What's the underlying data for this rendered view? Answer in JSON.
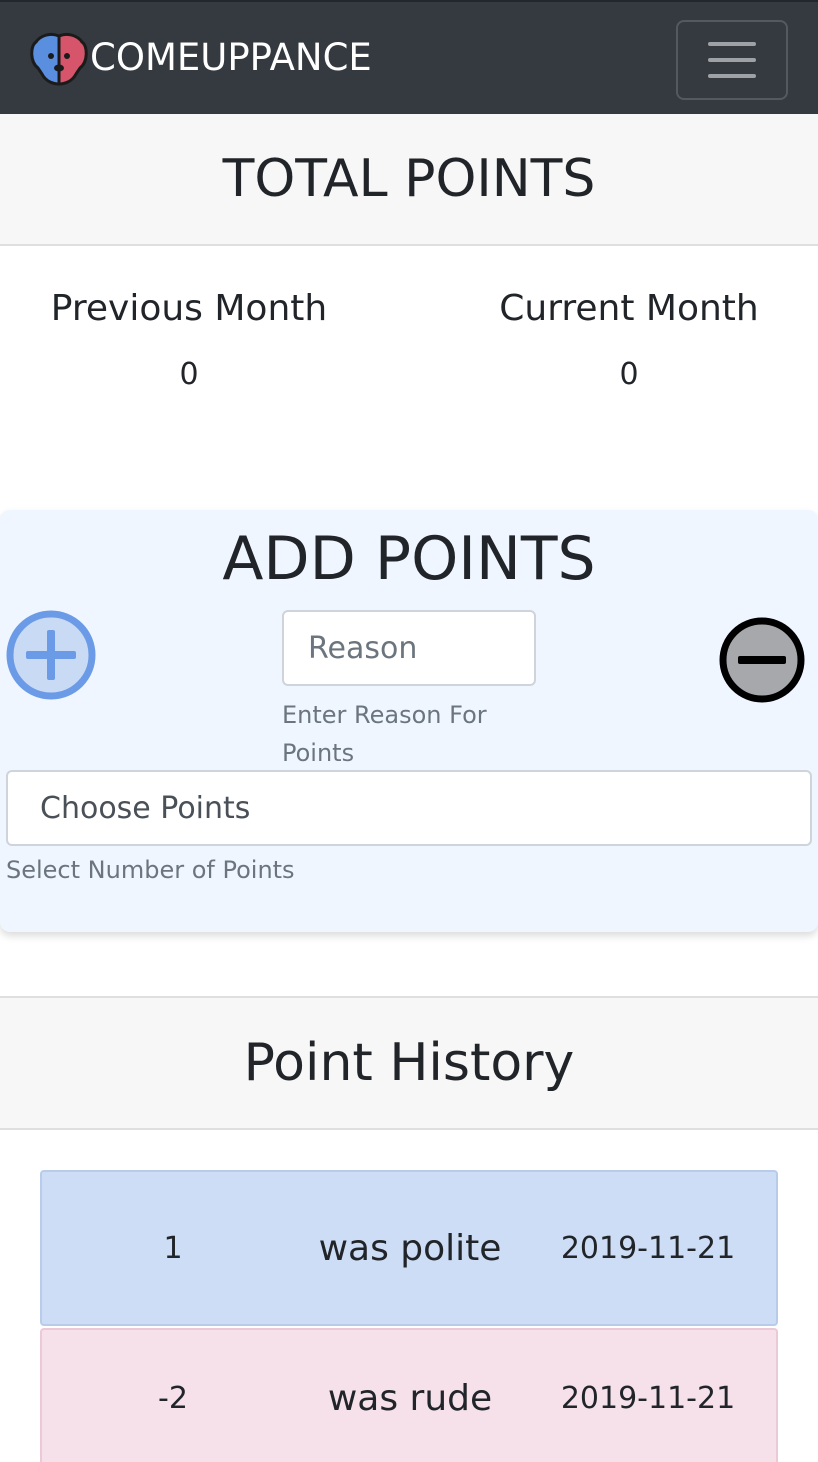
{
  "navbar": {
    "brand": "COMEUPPANCE",
    "logo_icon": "dog-face-logo-icon",
    "toggler_icon": "hamburger-menu-icon"
  },
  "total_points": {
    "title": "TOTAL POINTS",
    "previous_month": {
      "label": "Previous Month",
      "value": "0"
    },
    "current_month": {
      "label": "Current Month",
      "value": "0"
    }
  },
  "add_points": {
    "title": "ADD POINTS",
    "plus_icon": "plus-circle-icon",
    "minus_icon": "minus-circle-icon",
    "reason_placeholder": "Reason",
    "reason_help": "Enter Reason For Points",
    "points_select_value": "Choose Points",
    "points_help": "Select Number of Points",
    "colors": {
      "plus": "#6b9be6",
      "minus": "#000000",
      "card_bg": "#eff6ff"
    }
  },
  "point_history": {
    "title": "Point History",
    "rows": [
      {
        "points": "1",
        "reason": "was polite",
        "date": "2019-11-21",
        "type": "positive",
        "color": "#cdddf5"
      },
      {
        "points": "-2",
        "reason": "was rude",
        "date": "2019-11-21",
        "type": "negative",
        "color": "#f6e1ea"
      }
    ]
  }
}
